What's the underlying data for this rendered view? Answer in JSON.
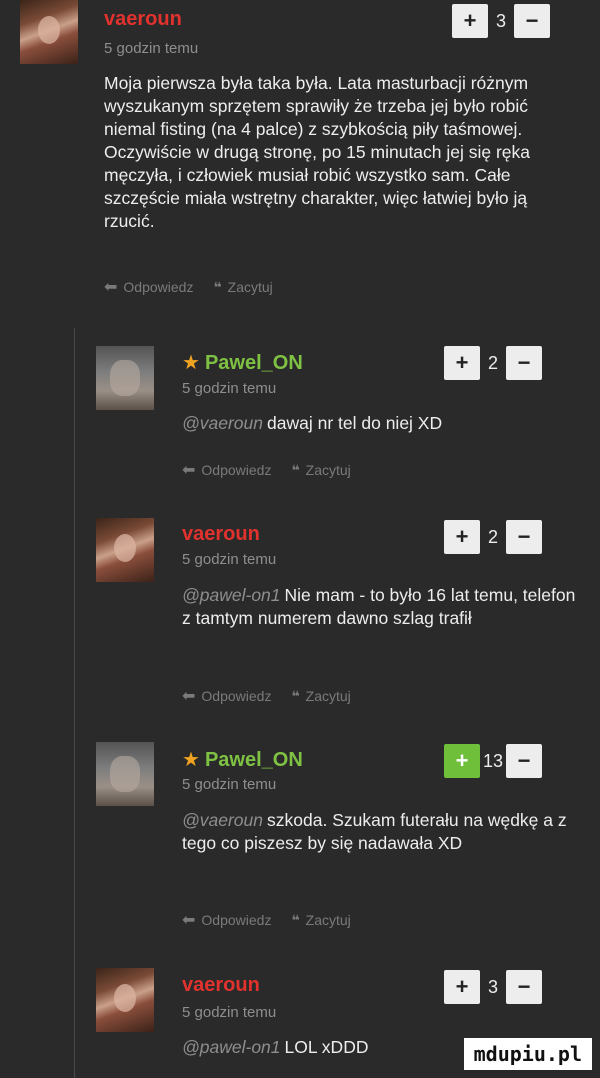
{
  "labels": {
    "reply": "Odpowiedz",
    "quote": "Zacytuj",
    "plus": "+",
    "minus": "−"
  },
  "icons": {
    "reply": "reply-arrow-icon",
    "quote": "quote-icon",
    "star": "star-icon"
  },
  "colors": {
    "background": "#2a2a2a",
    "username_red": "#e2322e",
    "username_green": "#7fc243",
    "star": "#f0a321",
    "vote_active": "#6fbf3a"
  },
  "comments": [
    {
      "user": "vaeroun",
      "time": "5 godzin temu",
      "votes": "3",
      "text": "Moja pierwsza była taka była. Lata masturbacji różnym wyszukanym sprzętem sprawiły że trzeba jej było robić niemal fisting (na 4 palce) z szybkością piły taśmowej. Oczywiście w drugą stronę, po 15 minutach jej się ręka męczyła, i człowiek musiał robić wszystko sam. Całe szczęście miała wstrętny charakter, więc łatwiej było ją rzucić."
    },
    {
      "user": "Pawel_ON",
      "time": "5 godzin temu",
      "votes": "2",
      "mention": "@vaeroun",
      "text": "dawaj nr tel do niej XD"
    },
    {
      "user": "vaeroun",
      "time": "5 godzin temu",
      "votes": "2",
      "mention": "@pawel-on1",
      "text": "Nie mam - to było 16 lat temu, telefon z tamtym numerem dawno szlag trafił"
    },
    {
      "user": "Pawel_ON",
      "time": "5 godzin temu",
      "votes": "13",
      "mention": "@vaeroun",
      "text": "szkoda. Szukam futerału na wędkę a z tego co piszesz by się nadawała XD"
    },
    {
      "user": "vaeroun",
      "time": "5 godzin temu",
      "votes": "3",
      "mention": "@pawel-on1",
      "text": "LOL xDDD"
    }
  ],
  "watermark": "mdupiu.pl"
}
